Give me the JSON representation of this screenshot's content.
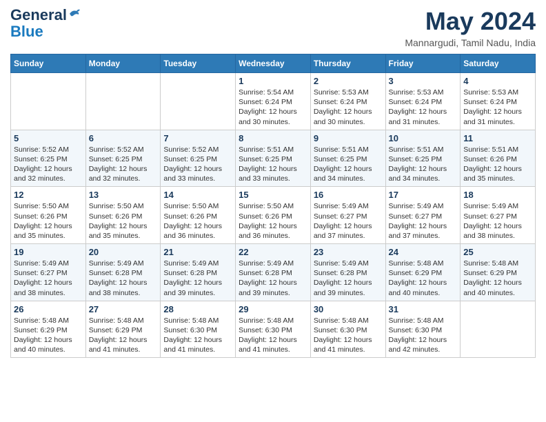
{
  "header": {
    "logo_line1": "General",
    "logo_line2": "Blue",
    "month_year": "May 2024",
    "location": "Mannargudi, Tamil Nadu, India"
  },
  "days_of_week": [
    "Sunday",
    "Monday",
    "Tuesday",
    "Wednesday",
    "Thursday",
    "Friday",
    "Saturday"
  ],
  "weeks": [
    [
      {
        "day": "",
        "info": ""
      },
      {
        "day": "",
        "info": ""
      },
      {
        "day": "",
        "info": ""
      },
      {
        "day": "1",
        "info": "Sunrise: 5:54 AM\nSunset: 6:24 PM\nDaylight: 12 hours\nand 30 minutes."
      },
      {
        "day": "2",
        "info": "Sunrise: 5:53 AM\nSunset: 6:24 PM\nDaylight: 12 hours\nand 30 minutes."
      },
      {
        "day": "3",
        "info": "Sunrise: 5:53 AM\nSunset: 6:24 PM\nDaylight: 12 hours\nand 31 minutes."
      },
      {
        "day": "4",
        "info": "Sunrise: 5:53 AM\nSunset: 6:24 PM\nDaylight: 12 hours\nand 31 minutes."
      }
    ],
    [
      {
        "day": "5",
        "info": "Sunrise: 5:52 AM\nSunset: 6:25 PM\nDaylight: 12 hours\nand 32 minutes."
      },
      {
        "day": "6",
        "info": "Sunrise: 5:52 AM\nSunset: 6:25 PM\nDaylight: 12 hours\nand 32 minutes."
      },
      {
        "day": "7",
        "info": "Sunrise: 5:52 AM\nSunset: 6:25 PM\nDaylight: 12 hours\nand 33 minutes."
      },
      {
        "day": "8",
        "info": "Sunrise: 5:51 AM\nSunset: 6:25 PM\nDaylight: 12 hours\nand 33 minutes."
      },
      {
        "day": "9",
        "info": "Sunrise: 5:51 AM\nSunset: 6:25 PM\nDaylight: 12 hours\nand 34 minutes."
      },
      {
        "day": "10",
        "info": "Sunrise: 5:51 AM\nSunset: 6:25 PM\nDaylight: 12 hours\nand 34 minutes."
      },
      {
        "day": "11",
        "info": "Sunrise: 5:51 AM\nSunset: 6:26 PM\nDaylight: 12 hours\nand 35 minutes."
      }
    ],
    [
      {
        "day": "12",
        "info": "Sunrise: 5:50 AM\nSunset: 6:26 PM\nDaylight: 12 hours\nand 35 minutes."
      },
      {
        "day": "13",
        "info": "Sunrise: 5:50 AM\nSunset: 6:26 PM\nDaylight: 12 hours\nand 35 minutes."
      },
      {
        "day": "14",
        "info": "Sunrise: 5:50 AM\nSunset: 6:26 PM\nDaylight: 12 hours\nand 36 minutes."
      },
      {
        "day": "15",
        "info": "Sunrise: 5:50 AM\nSunset: 6:26 PM\nDaylight: 12 hours\nand 36 minutes."
      },
      {
        "day": "16",
        "info": "Sunrise: 5:49 AM\nSunset: 6:27 PM\nDaylight: 12 hours\nand 37 minutes."
      },
      {
        "day": "17",
        "info": "Sunrise: 5:49 AM\nSunset: 6:27 PM\nDaylight: 12 hours\nand 37 minutes."
      },
      {
        "day": "18",
        "info": "Sunrise: 5:49 AM\nSunset: 6:27 PM\nDaylight: 12 hours\nand 38 minutes."
      }
    ],
    [
      {
        "day": "19",
        "info": "Sunrise: 5:49 AM\nSunset: 6:27 PM\nDaylight: 12 hours\nand 38 minutes."
      },
      {
        "day": "20",
        "info": "Sunrise: 5:49 AM\nSunset: 6:28 PM\nDaylight: 12 hours\nand 38 minutes."
      },
      {
        "day": "21",
        "info": "Sunrise: 5:49 AM\nSunset: 6:28 PM\nDaylight: 12 hours\nand 39 minutes."
      },
      {
        "day": "22",
        "info": "Sunrise: 5:49 AM\nSunset: 6:28 PM\nDaylight: 12 hours\nand 39 minutes."
      },
      {
        "day": "23",
        "info": "Sunrise: 5:49 AM\nSunset: 6:28 PM\nDaylight: 12 hours\nand 39 minutes."
      },
      {
        "day": "24",
        "info": "Sunrise: 5:48 AM\nSunset: 6:29 PM\nDaylight: 12 hours\nand 40 minutes."
      },
      {
        "day": "25",
        "info": "Sunrise: 5:48 AM\nSunset: 6:29 PM\nDaylight: 12 hours\nand 40 minutes."
      }
    ],
    [
      {
        "day": "26",
        "info": "Sunrise: 5:48 AM\nSunset: 6:29 PM\nDaylight: 12 hours\nand 40 minutes."
      },
      {
        "day": "27",
        "info": "Sunrise: 5:48 AM\nSunset: 6:29 PM\nDaylight: 12 hours\nand 41 minutes."
      },
      {
        "day": "28",
        "info": "Sunrise: 5:48 AM\nSunset: 6:30 PM\nDaylight: 12 hours\nand 41 minutes."
      },
      {
        "day": "29",
        "info": "Sunrise: 5:48 AM\nSunset: 6:30 PM\nDaylight: 12 hours\nand 41 minutes."
      },
      {
        "day": "30",
        "info": "Sunrise: 5:48 AM\nSunset: 6:30 PM\nDaylight: 12 hours\nand 41 minutes."
      },
      {
        "day": "31",
        "info": "Sunrise: 5:48 AM\nSunset: 6:30 PM\nDaylight: 12 hours\nand 42 minutes."
      },
      {
        "day": "",
        "info": ""
      }
    ]
  ]
}
